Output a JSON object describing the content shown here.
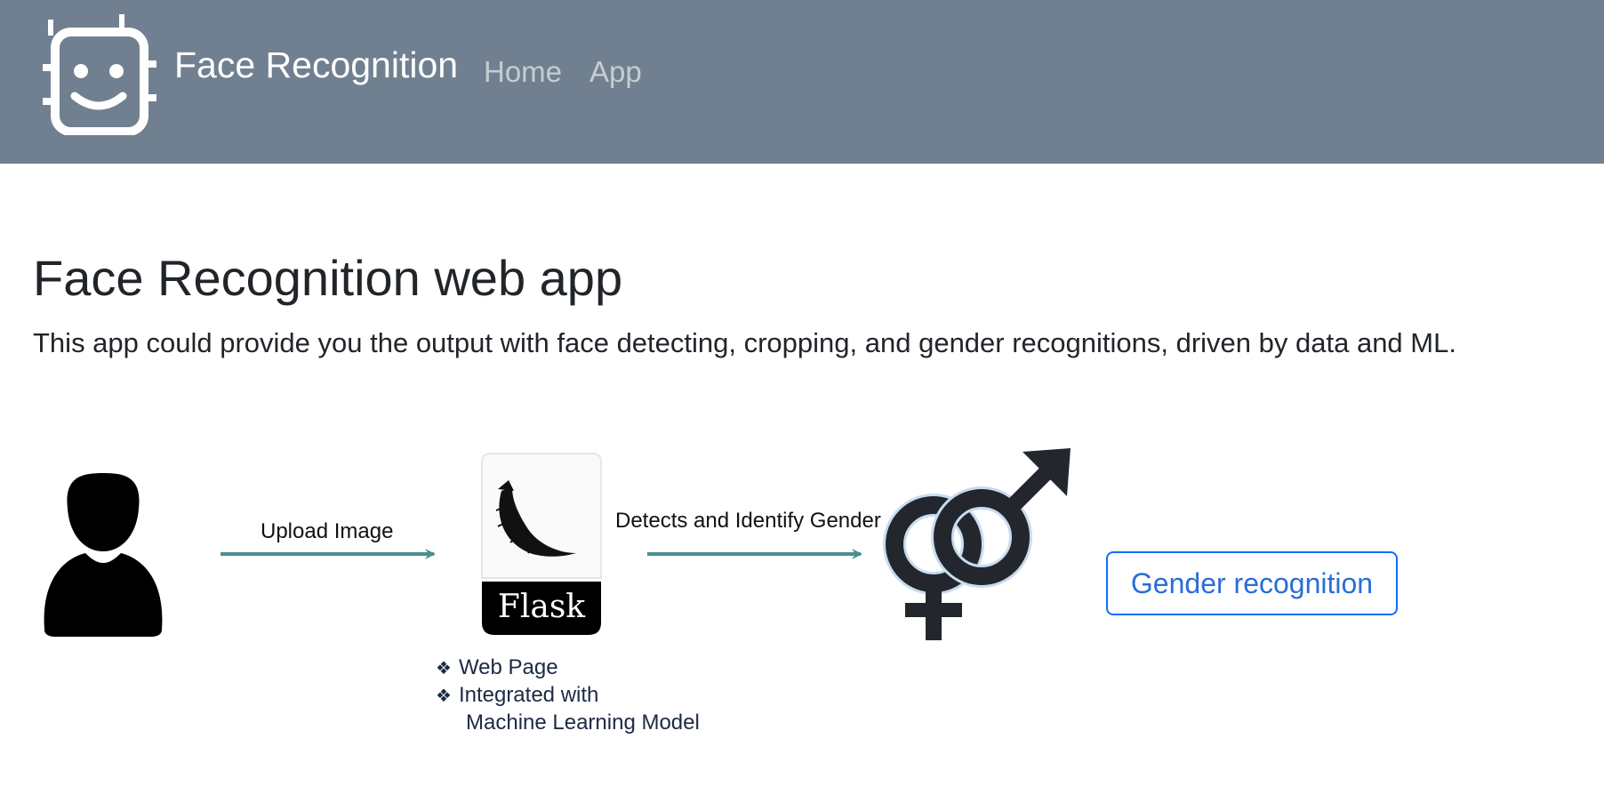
{
  "navbar": {
    "brand_name": "Face Recognition",
    "brand_icon": "robot-face-icon",
    "links": [
      {
        "label": "Home"
      },
      {
        "label": "App"
      }
    ],
    "background_color": "#708090"
  },
  "main": {
    "title": "Face Recognition web app",
    "description": "This app could provide you the output with face detecting, cropping, and gender recognitions, driven by data and ML."
  },
  "diagram": {
    "user_icon": "user-silhouette-icon",
    "upload_label": "Upload Image",
    "flask_label": "Flask",
    "flask_icon": "flask-horn-icon",
    "detect_label": "Detects and Identify Gender",
    "gender_icon": "gender-symbols-icon",
    "bullet_mark": "❖",
    "bullets": {
      "item1": "Web Page",
      "item2_line1": "Integrated with",
      "item2_line2": "Machine Learning Model"
    },
    "arrow_color": "#4a8f8f"
  },
  "actions": {
    "gender_button": "Gender recognition",
    "button_color": "#0d6efd"
  }
}
